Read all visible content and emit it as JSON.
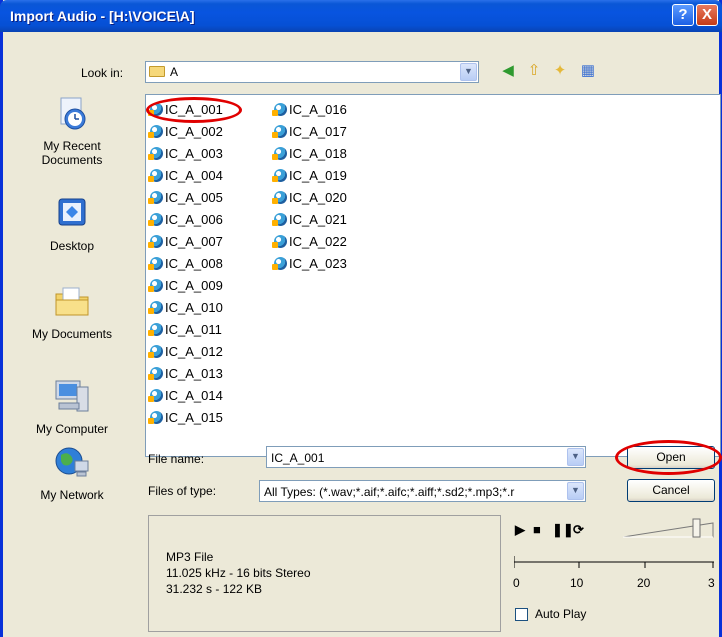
{
  "window": {
    "title": "Import Audio - [H:\\VOICE\\A]",
    "help_button": "?",
    "close_button": "X"
  },
  "lookin": {
    "label": "Look in:",
    "value": "A"
  },
  "places": [
    {
      "label": "My Recent Documents",
      "icon": "recent-documents-icon"
    },
    {
      "label": "Desktop",
      "icon": "desktop-icon"
    },
    {
      "label": "My Documents",
      "icon": "my-documents-icon"
    },
    {
      "label": "My Computer",
      "icon": "my-computer-icon"
    },
    {
      "label": "My Network",
      "icon": "my-network-icon"
    }
  ],
  "files": [
    "IC_A_001",
    "IC_A_002",
    "IC_A_003",
    "IC_A_004",
    "IC_A_005",
    "IC_A_006",
    "IC_A_007",
    "IC_A_008",
    "IC_A_009",
    "IC_A_010",
    "IC_A_011",
    "IC_A_012",
    "IC_A_013",
    "IC_A_014",
    "IC_A_015",
    "IC_A_016",
    "IC_A_017",
    "IC_A_018",
    "IC_A_019",
    "IC_A_020",
    "IC_A_021",
    "IC_A_022",
    "IC_A_023"
  ],
  "form": {
    "filename_label": "File name:",
    "filename_value": "IC_A_001",
    "filetype_label": "Files of type:",
    "filetype_value": "All Types: (*.wav;*.aif;*.aifc;*.aiff;*.sd2;*.mp3;*.r",
    "open_label": "Open",
    "cancel_label": "Cancel"
  },
  "info": {
    "line1": "MP3 File",
    "line2": "11.025 kHz - 16 bits Stereo",
    "line3": "31.232 s - 122 KB"
  },
  "ruler": {
    "ticks": [
      "0",
      "10",
      "20",
      "3"
    ]
  },
  "autoplay_label": "Auto Play",
  "colors": {
    "highlight": "#e00000",
    "titlebar": "#0854e0"
  }
}
